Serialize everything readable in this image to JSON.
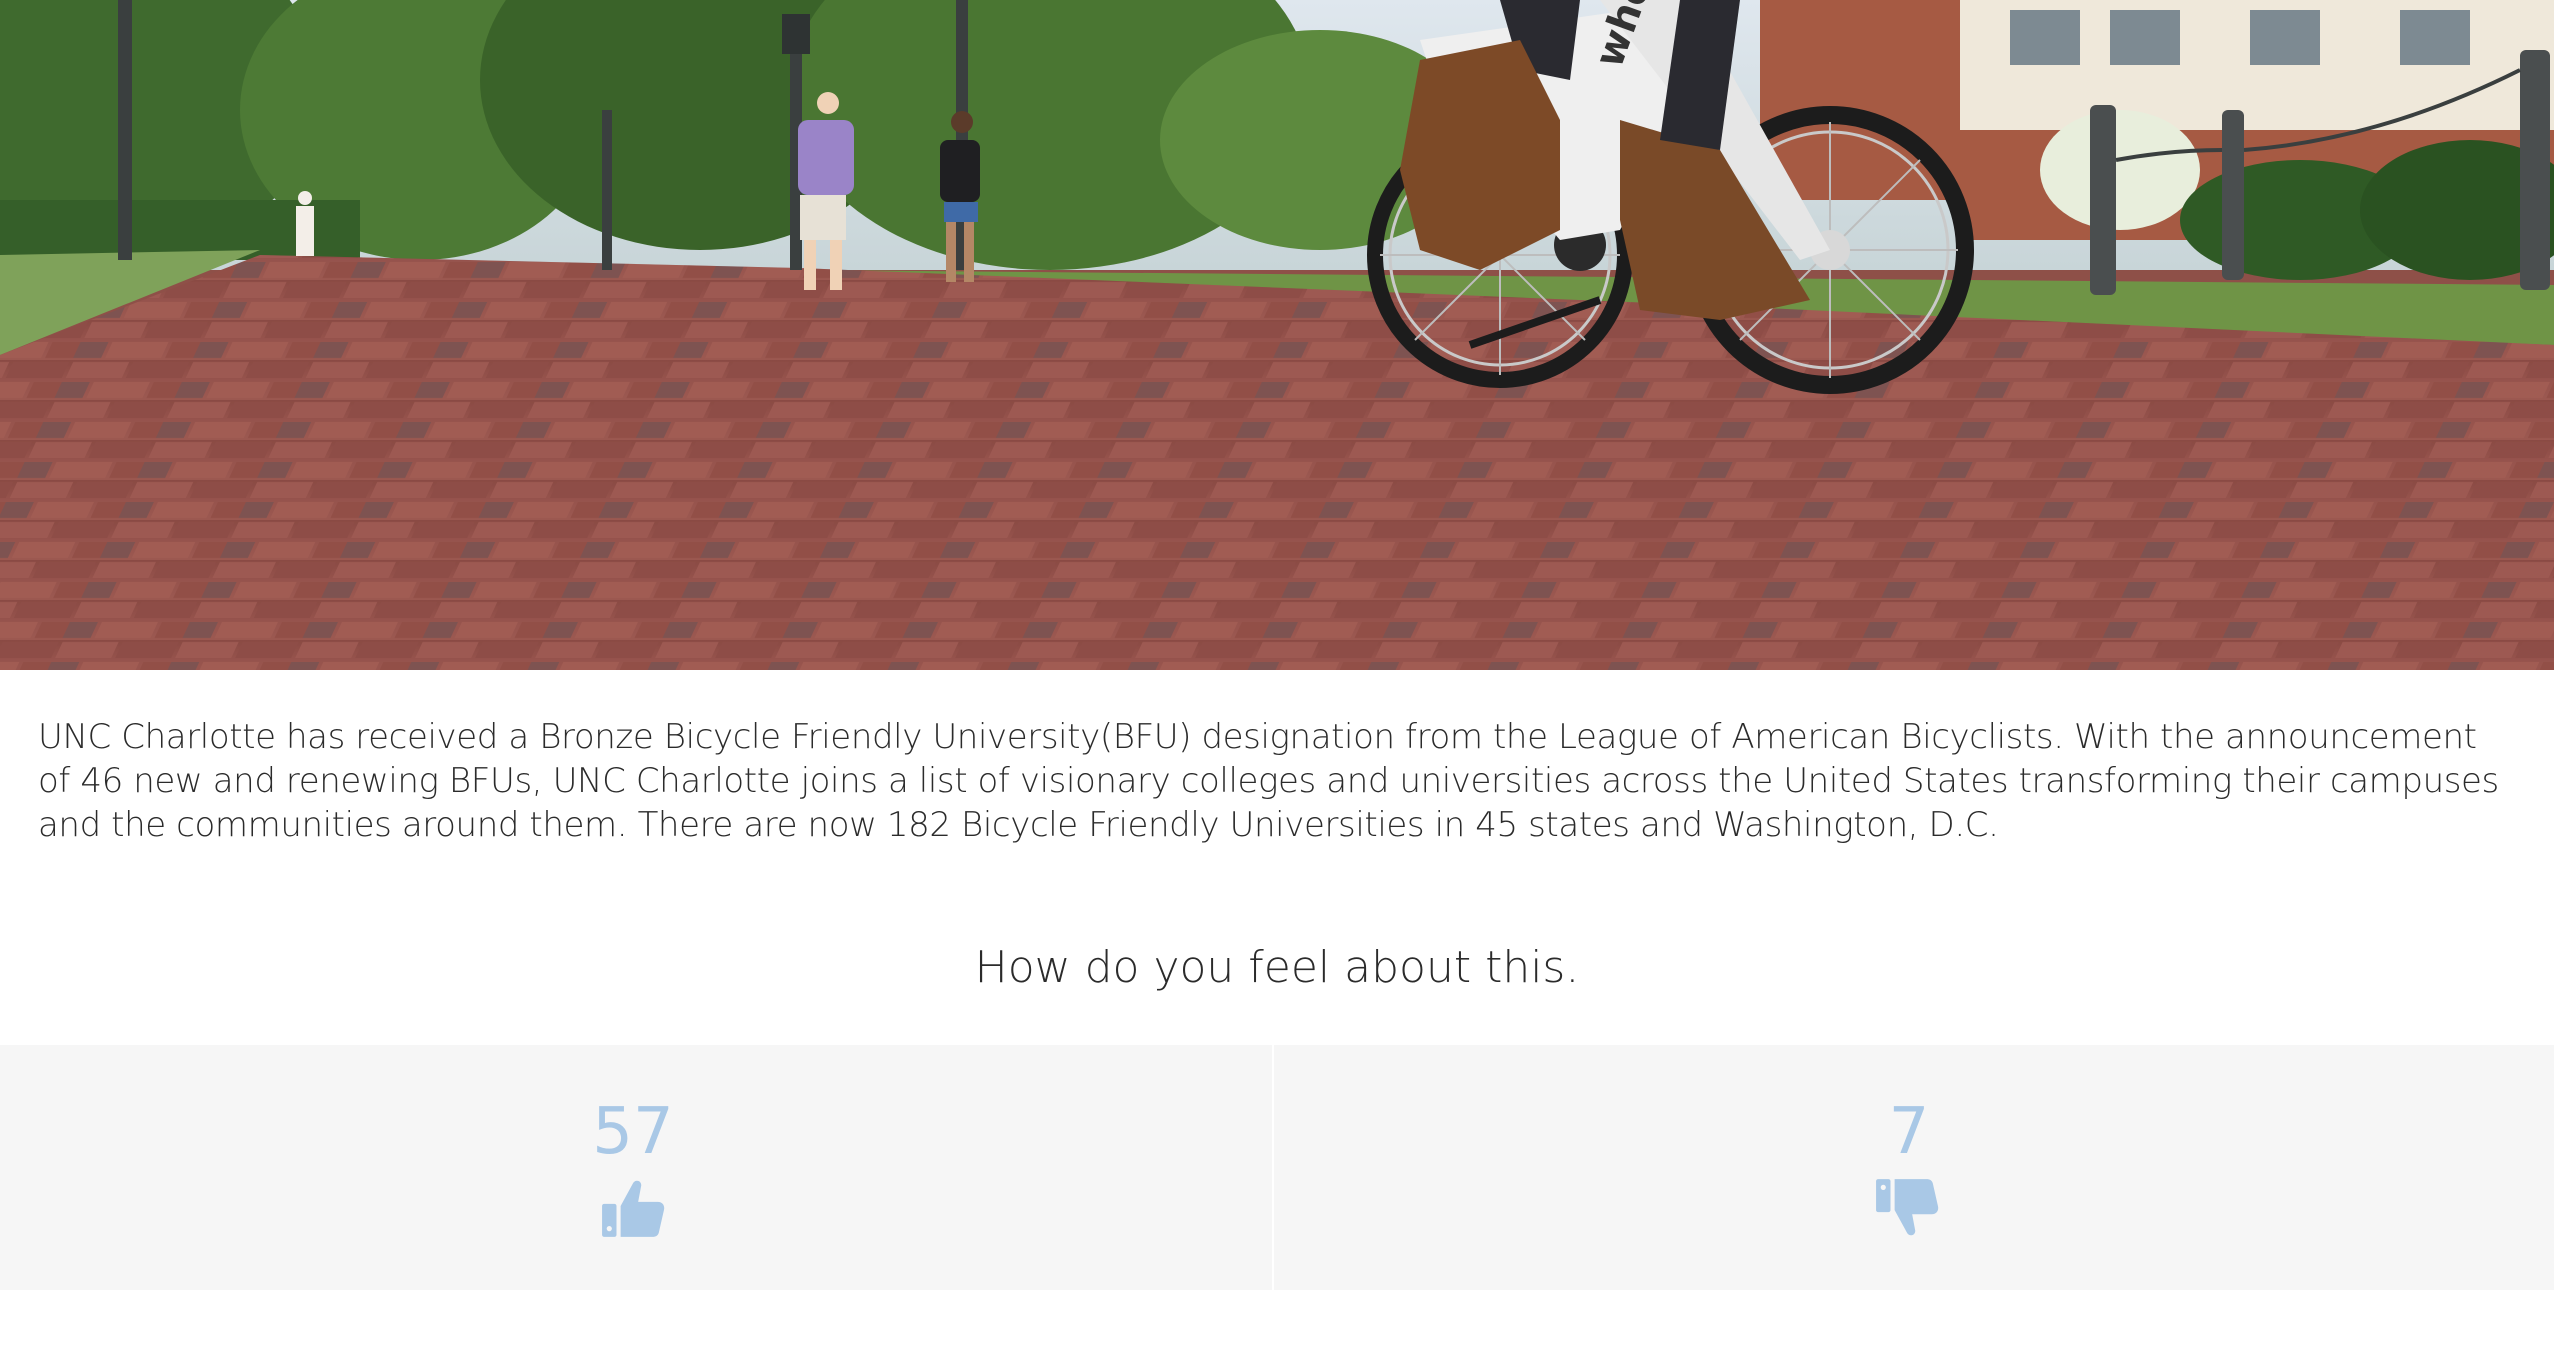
{
  "hero": {
    "image_description_icon": "campus-bicycle-photo",
    "bike_brand_text": "wheels"
  },
  "article": {
    "text": "UNC Charlotte has received a Bronze Bicycle Friendly University(BFU) designation from the League of American Bicyclists. With the announcement of 46 new and renewing BFUs, UNC Charlotte joins a list of visionary colleges and universities across the United States transforming their campuses and the communities around them. There are now 182 Bicycle Friendly Universities in 45 states and Washington, D.C."
  },
  "poll": {
    "question": "How do you feel about this.",
    "like": {
      "count": "57",
      "icon": "thumbs-up-icon"
    },
    "dislike": {
      "count": "7",
      "icon": "thumbs-down-icon"
    },
    "accent_color": "#a9c8e6"
  }
}
